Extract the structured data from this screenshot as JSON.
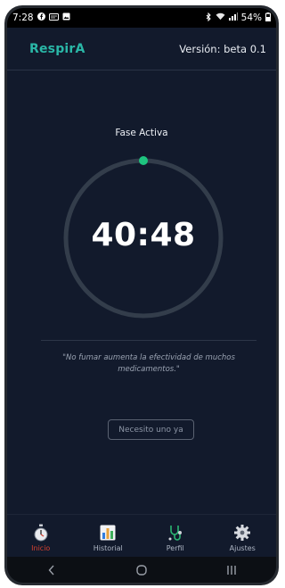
{
  "status_bar": {
    "time": "7:28",
    "battery": "54%"
  },
  "header": {
    "brand": "RespirA",
    "version": "Versión: beta 0.1"
  },
  "main": {
    "phase_label": "Fase Activa",
    "timer": "40:48",
    "progress_fraction": 0.0,
    "quote": "\"No fumar aumenta la efectividad de muchos medicamentos.\"",
    "need_button": "Necesito uno ya"
  },
  "tabs": [
    {
      "label": "Inicio",
      "icon": "stopwatch-icon",
      "active": true
    },
    {
      "label": "Historial",
      "icon": "bar-chart-icon",
      "active": false
    },
    {
      "label": "Perfil",
      "icon": "stethoscope-icon",
      "active": false
    },
    {
      "label": "Ajustes",
      "icon": "gear-icon",
      "active": false
    }
  ],
  "colors": {
    "background": "#121a2c",
    "brand": "#2ab7a7",
    "progress_dot": "#1ec47f",
    "ring": "#333d4b",
    "active_tab": "#d6402f"
  }
}
